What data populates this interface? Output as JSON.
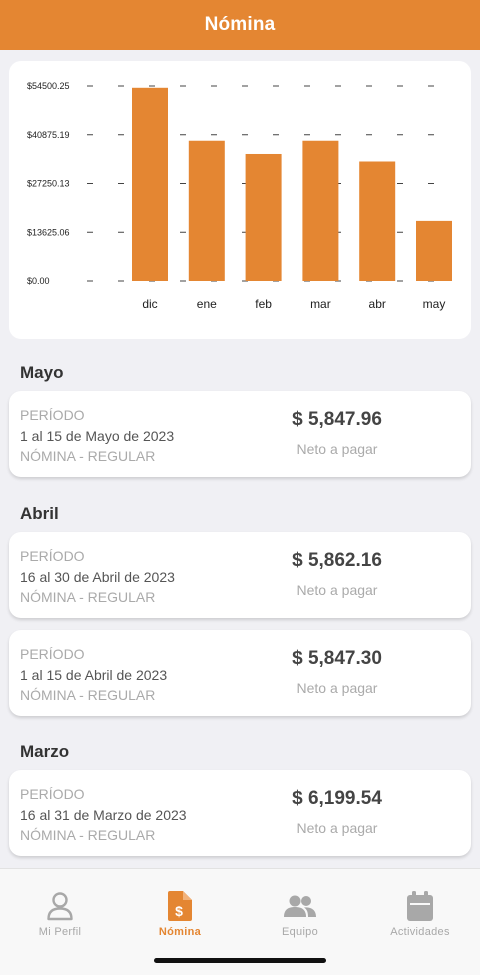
{
  "header": {
    "title": "Nómina"
  },
  "chart_data": {
    "type": "bar",
    "categories": [
      "dic",
      "ene",
      "feb",
      "mar",
      "abr",
      "may"
    ],
    "values": [
      54000,
      39200,
      35500,
      39200,
      33400,
      16800
    ],
    "yticks": [
      "$54500.25",
      "$40875.19",
      "$27250.13",
      "$13625.06",
      "$0.00"
    ],
    "ylim": [
      0,
      54500.25
    ],
    "bar_color": "#e48632",
    "grid": "dashed-horizontal"
  },
  "sections": [
    {
      "title": "Mayo",
      "items": [
        {
          "label": "PERÍODO",
          "range": "1 al 15 de Mayo de 2023",
          "type": "NÓMINA - REGULAR",
          "amount": "$ 5,847.96",
          "net": "Neto a pagar"
        }
      ]
    },
    {
      "title": "Abril",
      "items": [
        {
          "label": "PERÍODO",
          "range": "16 al 30 de Abril de 2023",
          "type": "NÓMINA - REGULAR",
          "amount": "$ 5,862.16",
          "net": "Neto a pagar"
        },
        {
          "label": "PERÍODO",
          "range": "1 al 15 de Abril de 2023",
          "type": "NÓMINA - REGULAR",
          "amount": "$ 5,847.30",
          "net": "Neto a pagar"
        }
      ]
    },
    {
      "title": "Marzo",
      "items": [
        {
          "label": "PERÍODO",
          "range": "16 al 31 de Marzo de 2023",
          "type": "NÓMINA - REGULAR",
          "amount": "$ 6,199.54",
          "net": "Neto a pagar"
        }
      ]
    }
  ],
  "tabs": [
    {
      "label": "Mi Perfil",
      "icon": "person-icon",
      "active": false
    },
    {
      "label": "Nómina",
      "icon": "payroll-document-icon",
      "active": true
    },
    {
      "label": "Equipo",
      "icon": "team-icon",
      "active": false
    },
    {
      "label": "Actividades",
      "icon": "calendar-icon",
      "active": false
    }
  ],
  "colors": {
    "accent": "#e48632",
    "background": "#f0f0f4"
  }
}
